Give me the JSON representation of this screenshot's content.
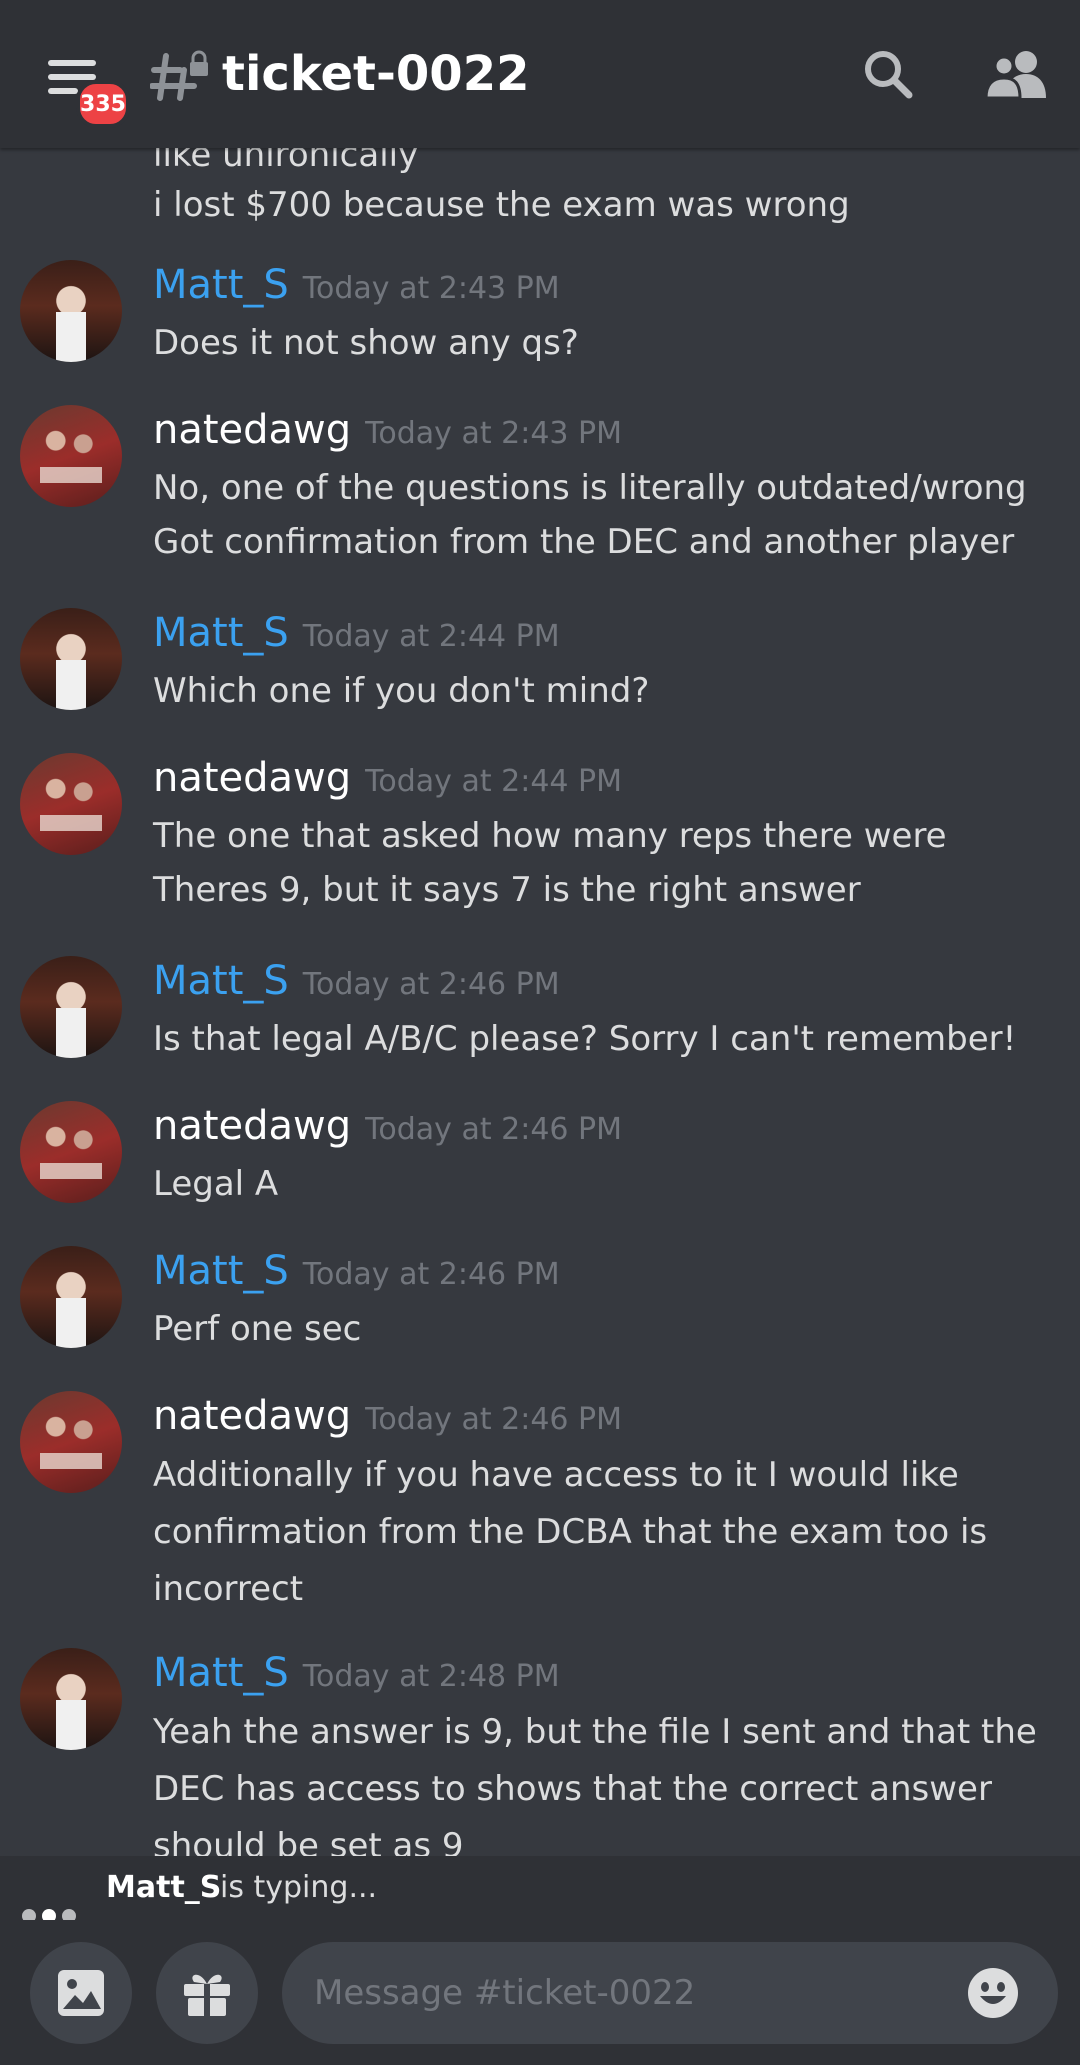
{
  "header": {
    "title": "ticket-0022",
    "badge_count": "335",
    "icons": [
      "hamburger-menu-icon",
      "locked-channel-hash-icon",
      "search-icon",
      "members-icon"
    ]
  },
  "messages": {
    "clipped_top_line": "like unironically",
    "top_line": "i lost $700 because the exam was wrong",
    "items": [
      {
        "author": "Matt_S",
        "time": "Today at 2:43 PM",
        "lines": [
          "Does it not show any qs?"
        ]
      },
      {
        "author": "natedawg",
        "time": "Today at 2:43 PM",
        "lines": [
          "No, one of the questions is literally outdated/wrong",
          "Got confirmation from the DEC and another player"
        ]
      },
      {
        "author": "Matt_S",
        "time": "Today at 2:44 PM",
        "lines": [
          "Which one if you don't mind?"
        ]
      },
      {
        "author": "natedawg",
        "time": "Today at 2:44 PM",
        "lines": [
          "The one that asked how many reps there were",
          "Theres 9, but it says 7 is the right answer"
        ]
      },
      {
        "author": "Matt_S",
        "time": "Today at 2:46 PM",
        "lines": [
          "Is that legal A/B/C please? Sorry I can't remember!"
        ]
      },
      {
        "author": "natedawg",
        "time": "Today at 2:46 PM",
        "lines": [
          "Legal A"
        ]
      },
      {
        "author": "Matt_S",
        "time": "Today at 2:46 PM",
        "lines": [
          "Perf one sec"
        ]
      },
      {
        "author": "natedawg",
        "time": "Today at 2:46 PM",
        "lines": [
          "Additionally if you have access to it I would like",
          "confirmation from the DCBA that the exam too is",
          "incorrect"
        ]
      },
      {
        "author": "Matt_S",
        "time": "Today at 2:48 PM",
        "lines": [
          "Yeah the answer is 9, but the file I sent and that the",
          "DEC has access to shows that the correct answer",
          "should be set as 9"
        ]
      }
    ]
  },
  "typing": {
    "user": "Matt_S",
    "text": "is typing..."
  },
  "composer": {
    "placeholder": "Message #ticket-0022",
    "icons": [
      "image-upload-icon",
      "gift-icon",
      "emoji-icon"
    ]
  },
  "colors": {
    "background": "#36393f",
    "header": "#2f3136",
    "matt_name": "#3ba1f0",
    "timestamp": "#72767d",
    "badge": "#ed4245"
  }
}
